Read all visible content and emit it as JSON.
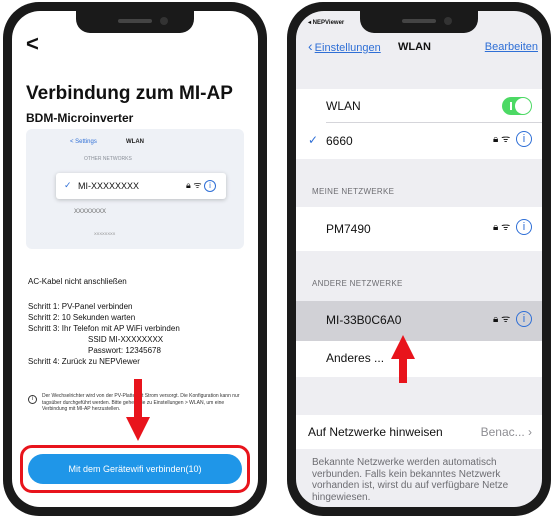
{
  "left": {
    "back": "<",
    "title": "Verbindung zum MI-AP",
    "subtitle": "BDM-Microinverter",
    "illustration": {
      "back": "< Settings",
      "title": "WLAN",
      "other_networks": "OTHER NETWORKS",
      "ssid": "MI-XXXXXXXX",
      "ssid2": "XXXXXXXX",
      "ssid3": "XXXXXXXX"
    },
    "note": "AC-Kabel nicht anschließen",
    "steps": [
      "Schritt 1: PV-Panel verbinden",
      "Schritt 2: 10 Sekunden warten",
      "Schritt 3: Ihr Telefon mit AP WiFi verbinden",
      "SSID MI-XXXXXXXX",
      "Passwort: 12345678",
      "Schritt 4: Zurück zu NEPViewer"
    ],
    "disclaimer": "Der Wechselrichter wird von der PV-Platte mit Strom versorgt. Die Konfiguration kann nur tagsüber durchgeführt werden. Bitte gehen Sie zu Einstellungen > WLAN, um eine Verbindung mit MI-AP herzustellen.",
    "cta": "Mit dem Gerätewifi verbinden(10)"
  },
  "right": {
    "status": "◂ NEPViewer",
    "nav_back": "Einstellungen",
    "nav_title": "WLAN",
    "nav_edit": "Bearbeiten",
    "wlan_label": "WLAN",
    "connected": "6660",
    "my_networks_head": "MEINE NETZWERKE",
    "my_networks": [
      "PM7490"
    ],
    "other_networks_head": "ANDERE NETZWERKE",
    "other_networks": [
      "MI-33B0C6A0"
    ],
    "other": "Anderes ...",
    "hint_label": "Auf Netzwerke hinweisen",
    "hint_value": "Benac...",
    "footer": "Bekannte Netzwerke werden automatisch verbunden. Falls kein bekanntes Netzwerk vorhanden ist, wirst du auf verfügbare Netze hingewiesen."
  },
  "colors": {
    "accent_blue": "#2f6fd6",
    "button_blue": "#1f96e8",
    "arrow_red": "#e8141c",
    "toggle_green": "#4cd964"
  }
}
